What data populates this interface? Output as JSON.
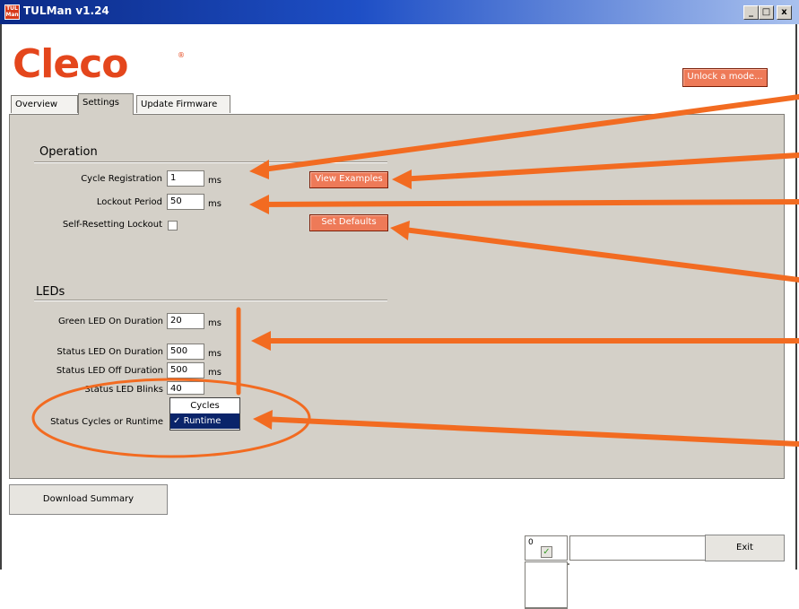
{
  "window": {
    "title": "TULMan v1.24",
    "icon_text": "TUL Man",
    "minimize": "_",
    "maximize": "□",
    "close": "x"
  },
  "brand": {
    "logo": "Cleco",
    "reg": "®"
  },
  "header": {
    "unlock_button": "Unlock a mode..."
  },
  "tabs": [
    {
      "label": "Overview",
      "active": false
    },
    {
      "label": "Settings",
      "active": true
    },
    {
      "label": "Update Firmware",
      "active": false
    }
  ],
  "operation": {
    "title": "Operation",
    "cycle_registration": {
      "label": "Cycle Registration",
      "value": "1",
      "unit": "ms"
    },
    "lockout_period": {
      "label": "Lockout Period",
      "value": "50",
      "unit": "ms"
    },
    "self_resetting": {
      "label": "Self-Resetting Lockout",
      "checked": false
    },
    "view_examples": "View Examples",
    "set_defaults": "Set Defaults"
  },
  "leds": {
    "title": "LEDs",
    "green_on": {
      "label": "Green LED On Duration",
      "value": "20",
      "unit": "ms"
    },
    "status_on": {
      "label": "Status LED On Duration",
      "value": "500",
      "unit": "ms"
    },
    "status_off": {
      "label": "Status LED Off Duration",
      "value": "500",
      "unit": "ms"
    },
    "status_blinks": {
      "label": "Status LED Blinks",
      "value": "40"
    },
    "cycles_or_runtime": {
      "label": "Status Cycles or Runtime",
      "options": [
        "Cycles",
        "Runtime"
      ],
      "selected": "Runtime",
      "check": "✓"
    }
  },
  "footer": {
    "download_summary": "Download Summary",
    "counter": "0",
    "exit": "Exit"
  },
  "colors": {
    "brand": "#e4461c",
    "annotation": "#f26b21",
    "panel": "#d4d0c8",
    "selection": "#0a246a"
  }
}
